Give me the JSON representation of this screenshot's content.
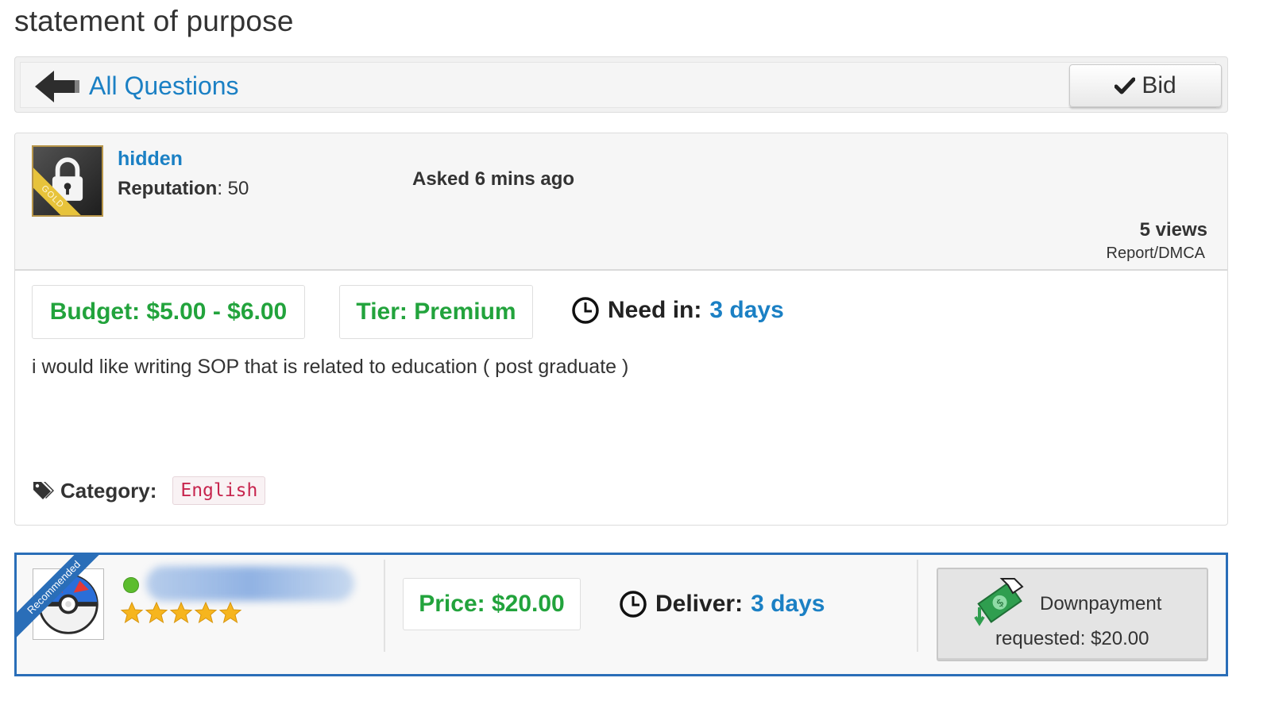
{
  "page": {
    "title": "statement of purpose"
  },
  "nav": {
    "back_label": "All Questions",
    "bid_label": "Bid"
  },
  "question": {
    "username": "hidden",
    "reputation_label": "Reputation",
    "reputation_value": ": 50",
    "avatar_badge": "GOLD",
    "asked": "Asked 6 mins ago",
    "views": "5 views",
    "report": "Report/DMCA",
    "budget": "Budget: $5.00 - $6.00",
    "tier": "Tier: Premium",
    "need_in_label": "Need in:",
    "need_in_value": "3 days",
    "description": "i would like writing SOP that is related to education ( post graduate )",
    "category_label": "Category:",
    "category_value": "English"
  },
  "bid": {
    "badge": "Recommended",
    "rating_stars": 5,
    "price": "Price: $20.00",
    "deliver_label": "Deliver:",
    "deliver_value": "3 days",
    "downpayment_line1": "Downpayment",
    "downpayment_line2": "requested: $20.00"
  },
  "colors": {
    "link": "#1b80c4",
    "price_green": "#22a33c",
    "bid_border": "#2a6eb8",
    "category_text": "#c7254e",
    "online": "#5cbd2e",
    "star": "#f6b51e"
  },
  "icons": [
    "back-arrow-icon",
    "check-icon",
    "lock-icon",
    "clock-icon",
    "tag-icon",
    "pokeball-icon",
    "star-icon",
    "money-icon"
  ]
}
